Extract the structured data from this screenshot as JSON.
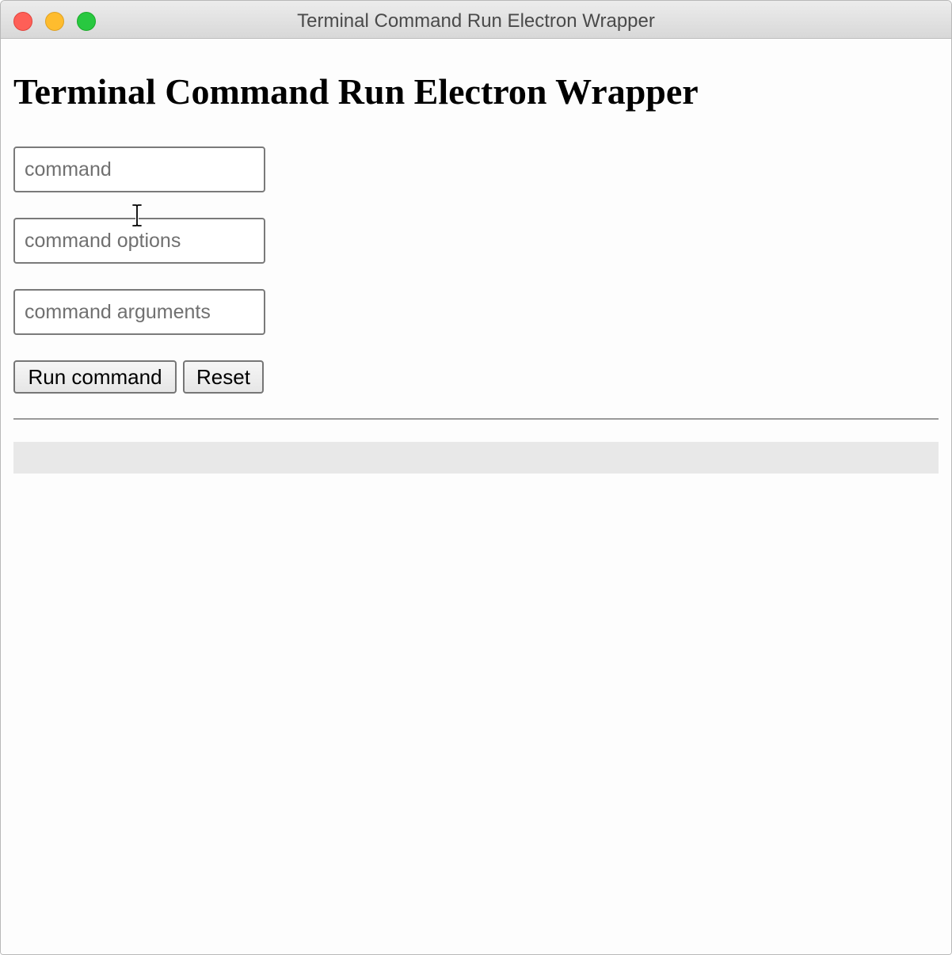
{
  "window": {
    "title": "Terminal Command Run Electron Wrapper",
    "controls": {
      "close_color": "#fe5f57",
      "minimize_color": "#febc2e",
      "zoom_color": "#28c840"
    }
  },
  "page": {
    "heading": "Terminal Command Run Electron Wrapper"
  },
  "form": {
    "command": {
      "value": "",
      "placeholder": "command"
    },
    "options": {
      "value": "",
      "placeholder": "command options"
    },
    "arguments": {
      "value": "",
      "placeholder": "command arguments"
    },
    "run_label": "Run command",
    "reset_label": "Reset"
  },
  "output": {
    "text": ""
  }
}
